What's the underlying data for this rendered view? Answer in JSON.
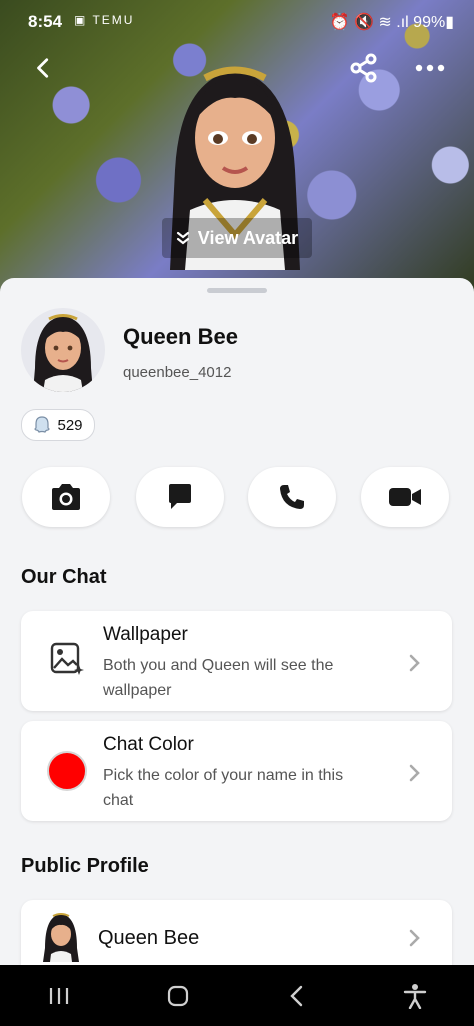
{
  "status_bar": {
    "time": "8:54",
    "left_icons": "▣ TEMU",
    "right_status": "⏰ 🔇 ≋ .ıl 99%▮"
  },
  "header": {
    "view_avatar_label": "View Avatar"
  },
  "profile": {
    "display_name": "Queen Bee",
    "username": "queenbee_4012",
    "snap_score": "529"
  },
  "actions": [
    {
      "name": "camera-icon"
    },
    {
      "name": "chat-icon"
    },
    {
      "name": "phone-icon"
    },
    {
      "name": "video-icon"
    }
  ],
  "our_chat": {
    "title": "Our Chat",
    "wallpaper": {
      "title": "Wallpaper",
      "description": "Both you and Queen will see the wallpaper"
    },
    "chat_color": {
      "title": "Chat Color",
      "description": "Pick the color of your name in this chat",
      "color": "#ff0000"
    }
  },
  "public_profile": {
    "title": "Public Profile",
    "name": "Queen Bee"
  },
  "colors": {
    "sheet_bg": "#f3f4f6",
    "card_bg": "#ffffff",
    "accent_red": "#ff0000"
  }
}
